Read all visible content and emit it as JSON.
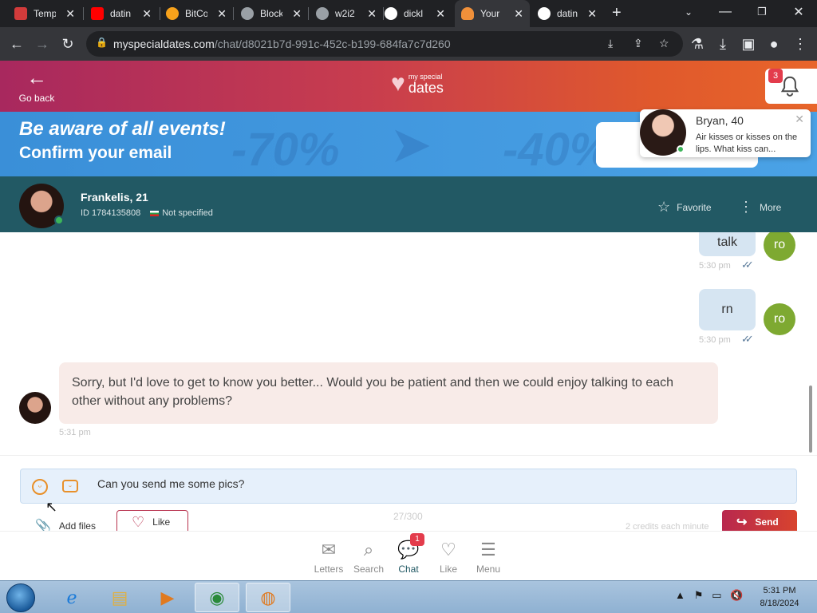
{
  "browser": {
    "tabs": [
      {
        "title": "Temp",
        "icon": "mail-icon",
        "color": "#d23b3b"
      },
      {
        "title": "datin",
        "icon": "youtube-icon",
        "color": "#ff0000"
      },
      {
        "title": "BitCo",
        "icon": "bitcoin-icon",
        "color": "#f7a21b"
      },
      {
        "title": "Block",
        "icon": "globe-icon",
        "color": "#9aa0a6"
      },
      {
        "title": "w2i2",
        "icon": "globe-icon",
        "color": "#9aa0a6"
      },
      {
        "title": "dickl",
        "icon": "google-icon",
        "color": "#ffffff"
      },
      {
        "title": "Your",
        "icon": "heart-icon",
        "color": "#f0903a"
      },
      {
        "title": "datin",
        "icon": "google-icon",
        "color": "#ffffff"
      }
    ],
    "url_host": "myspecialdates.com",
    "url_path": "/chat/d8021b7d-991c-452c-b199-684fa7c7d260"
  },
  "header": {
    "go_back": "Go back",
    "logo_small": "my special",
    "logo_big": "dates",
    "notifications": "3"
  },
  "promo": {
    "line1": "Be aware of all events!",
    "line2": "Confirm your email",
    "deco1": "-70%",
    "deco2": "-40%"
  },
  "toast": {
    "name": "Bryan, 40",
    "message": "Air kisses or kisses on the lips. What kiss can..."
  },
  "profile": {
    "name": "Frankelis, 21",
    "id": "ID 1784135808",
    "location": "Not specified",
    "favorite": "Favorite",
    "more": "More"
  },
  "chat": {
    "my_initials": "ro",
    "messages": [
      {
        "text": "talk",
        "time": "5:30 pm"
      },
      {
        "text": "rn",
        "time": "5:30 pm"
      }
    ],
    "incoming": {
      "text": "Sorry, but I'd love to get to know you better... Would you be patient and then we could enjoy talking to each other without any problems?",
      "time": "5:31 pm"
    }
  },
  "composer": {
    "input_value": "Can you send me some pics?",
    "add_files": "Add files",
    "like": "Like",
    "counter": "27/300",
    "credits": "2 credits each minute",
    "send": "Send"
  },
  "bottom_nav": {
    "items": [
      "Letters",
      "Search",
      "Chat",
      "Like",
      "Menu"
    ],
    "chat_badge": "1"
  },
  "taskbar": {
    "time": "5:31 PM",
    "date": "8/18/2024"
  },
  "colors": {
    "brand_teal": "#225964",
    "accent_red": "#b8324e",
    "my_avatar": "#7ea931"
  }
}
